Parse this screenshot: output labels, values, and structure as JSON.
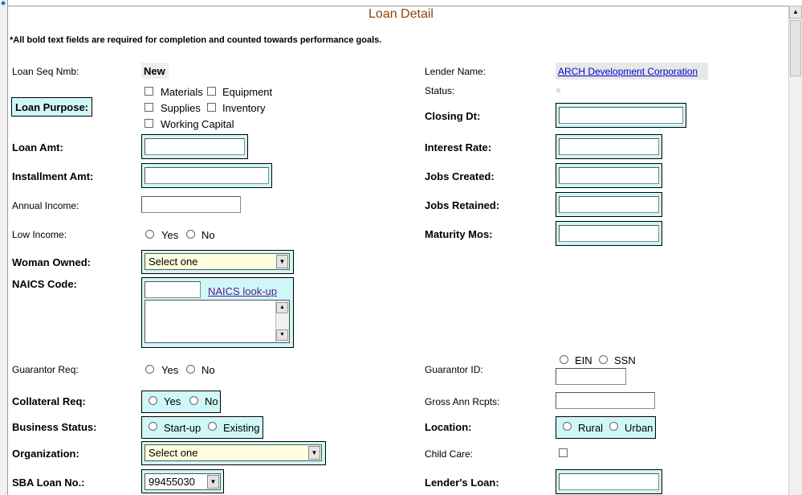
{
  "page": {
    "title": "Loan Detail",
    "note": "*All bold text fields are required for completion and counted towards performance goals."
  },
  "left": {
    "loan_seq_label": "Loan Seq Nmb:",
    "loan_seq_value": "New",
    "loan_purpose_label": "Loan Purpose:",
    "purposes": [
      "Materials",
      "Equipment",
      "Supplies",
      "Inventory",
      "Working Capital"
    ],
    "loan_amt_label": "Loan Amt:",
    "installment_label": "Installment Amt:",
    "annual_income_label": "Annual Income:",
    "low_income_label": "Low Income:",
    "woman_owned_label": "Woman Owned:",
    "woman_owned_value": "Select one",
    "naics_label": "NAICS Code:",
    "naics_link": "NAICS look-up",
    "guarantor_req_label": "Guarantor Req:",
    "collateral_req_label": "Collateral Req:",
    "business_status_label": "Business Status:",
    "business_status_options": [
      "Start-up",
      "Existing"
    ],
    "organization_label": "Organization:",
    "organization_value": "Select one",
    "sba_loan_label": "SBA Loan No.:",
    "sba_loan_value": "99455030"
  },
  "right": {
    "lender_name_label": "Lender Name:",
    "lender_name_value": "ARCH Development Corporation",
    "status_label": "Status:",
    "closing_dt_label": "Closing Dt:",
    "interest_rate_label": "Interest Rate:",
    "jobs_created_label": "Jobs Created:",
    "jobs_retained_label": "Jobs Retained:",
    "maturity_label": "Maturity Mos:",
    "guarantor_id_label": "Guarantor ID:",
    "guarantor_id_options": [
      "EIN",
      "SSN"
    ],
    "gross_ann_label": "Gross Ann Rcpts:",
    "location_label": "Location:",
    "location_options": [
      "Rural",
      "Urban"
    ],
    "child_care_label": "Child Care:",
    "lenders_loan_label": "Lender's Loan:"
  },
  "common": {
    "yes": "Yes",
    "no": "No"
  }
}
